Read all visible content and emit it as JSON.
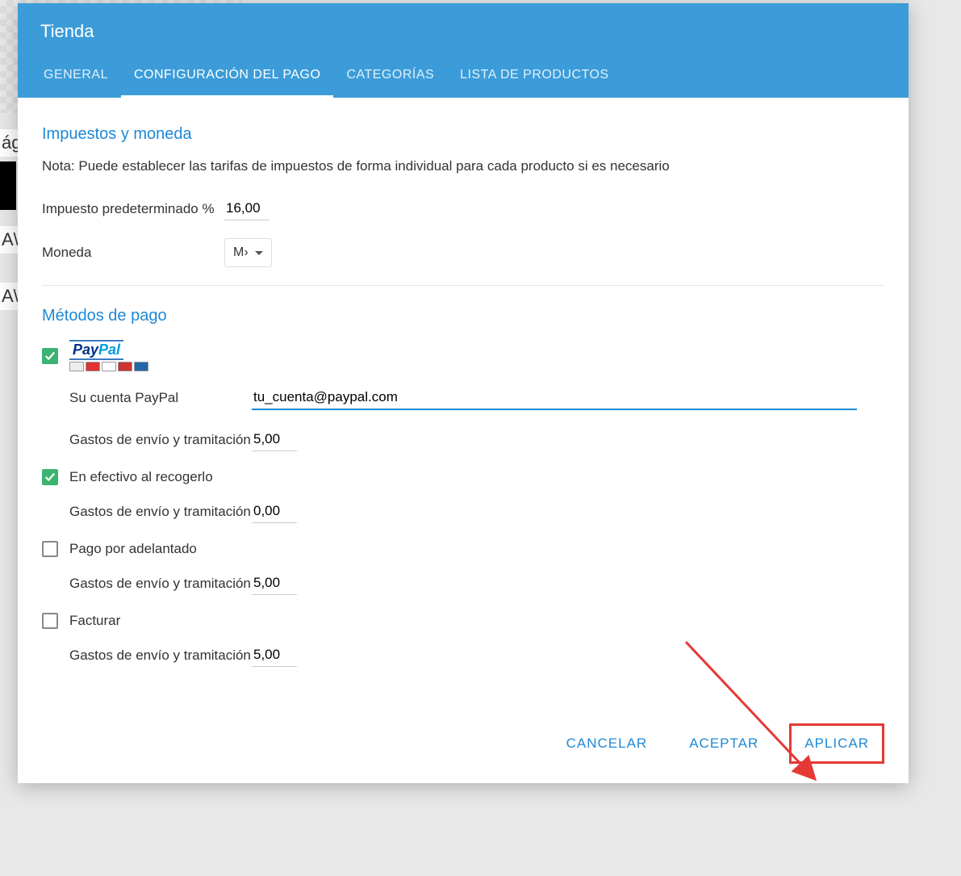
{
  "header": {
    "title": "Tienda",
    "tabs": [
      "GENERAL",
      "CONFIGURACIÓN DEL PAGO",
      "CATEGORÍAS",
      "LISTA DE PRODUCTOS"
    ]
  },
  "taxes": {
    "section_title": "Impuestos y moneda",
    "note": "Nota: Puede establecer las tarifas de impuestos de forma individual para cada producto si es necesario",
    "default_tax_label": "Impuesto predeterminado %",
    "default_tax_value": "16,00",
    "currency_label": "Moneda",
    "currency_value": "M›"
  },
  "methods": {
    "section_title": "Métodos de pago",
    "paypal": {
      "account_label": "Su cuenta PayPal",
      "account_value": "tu_cuenta@paypal.com",
      "shipping_label": "Gastos de envío y tramitación",
      "shipping_value": "5,00"
    },
    "cash": {
      "label": "En efectivo al recogerlo",
      "shipping_label": "Gastos de envío y tramitación",
      "shipping_value": "0,00"
    },
    "prepay": {
      "label": "Pago por adelantado",
      "shipping_label": "Gastos de envío y tramitación",
      "shipping_value": "5,00"
    },
    "invoice": {
      "label": "Facturar",
      "shipping_label": "Gastos de envío y tramitación",
      "shipping_value": "5,00"
    }
  },
  "footer": {
    "cancel": "CANCELAR",
    "accept": "ACEPTAR",
    "apply": "APLICAR"
  },
  "bg": {
    "frag1": "ág",
    "frag2": "A\\",
    "frag3": "A\\"
  }
}
